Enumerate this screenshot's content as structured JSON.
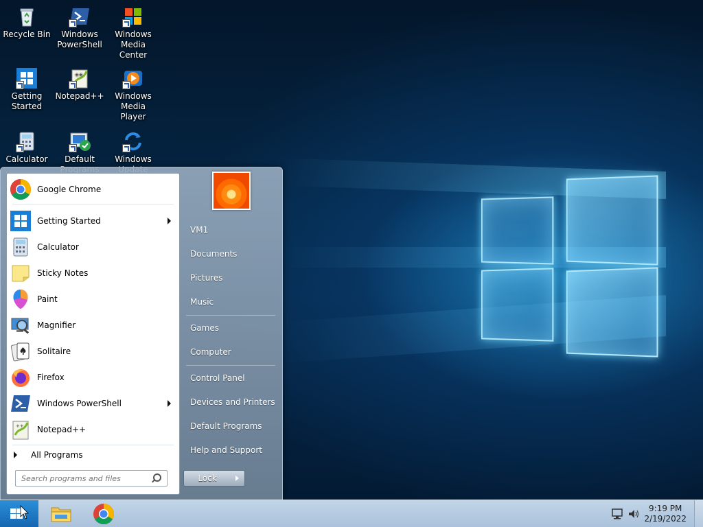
{
  "desktop": {
    "icons": [
      {
        "label": "Recycle Bin",
        "icon": "recycle-bin-icon"
      },
      {
        "label": "Windows PowerShell",
        "icon": "powershell-icon"
      },
      {
        "label": "Windows Media Center",
        "icon": "media-center-icon"
      },
      {
        "label": "Getting Started",
        "icon": "getting-started-icon"
      },
      {
        "label": "Notepad++",
        "icon": "notepad-plus-plus-icon"
      },
      {
        "label": "Windows Media Player",
        "icon": "media-player-icon"
      },
      {
        "label": "Calculator",
        "icon": "calculator-icon"
      },
      {
        "label": "Default Programs",
        "icon": "default-programs-icon"
      },
      {
        "label": "Windows Update",
        "icon": "windows-update-icon"
      }
    ]
  },
  "start_menu": {
    "programs": [
      {
        "label": "Google Chrome",
        "icon": "chrome-icon",
        "submenu": false
      },
      {
        "label": "Getting Started",
        "icon": "getting-started-icon",
        "submenu": true
      },
      {
        "label": "Calculator",
        "icon": "calculator-icon",
        "submenu": false
      },
      {
        "label": "Sticky Notes",
        "icon": "sticky-notes-icon",
        "submenu": false
      },
      {
        "label": "Paint",
        "icon": "paint-icon",
        "submenu": false
      },
      {
        "label": "Magnifier",
        "icon": "magnifier-icon",
        "submenu": false
      },
      {
        "label": "Solitaire",
        "icon": "solitaire-icon",
        "submenu": false
      },
      {
        "label": "Firefox",
        "icon": "firefox-icon",
        "submenu": false
      },
      {
        "label": "Windows PowerShell",
        "icon": "powershell-icon",
        "submenu": true
      },
      {
        "label": "Notepad++",
        "icon": "notepad-plus-plus-icon",
        "submenu": false
      }
    ],
    "all_programs_label": "All Programs",
    "search_placeholder": "Search programs and files",
    "user_name": "VM1",
    "right_links": [
      "Documents",
      "Pictures",
      "Music",
      "Games",
      "Computer",
      "Control Panel",
      "Devices and Printers",
      "Default Programs",
      "Help and Support"
    ],
    "lock_label": "Lock"
  },
  "taskbar": {
    "pinned": [
      {
        "name": "file-explorer-icon"
      },
      {
        "name": "chrome-icon"
      }
    ],
    "clock_time": "9:19 PM",
    "clock_date": "2/19/2022"
  },
  "colors": {
    "accent": "#1565b0",
    "taskbar": "#b9cde2"
  }
}
